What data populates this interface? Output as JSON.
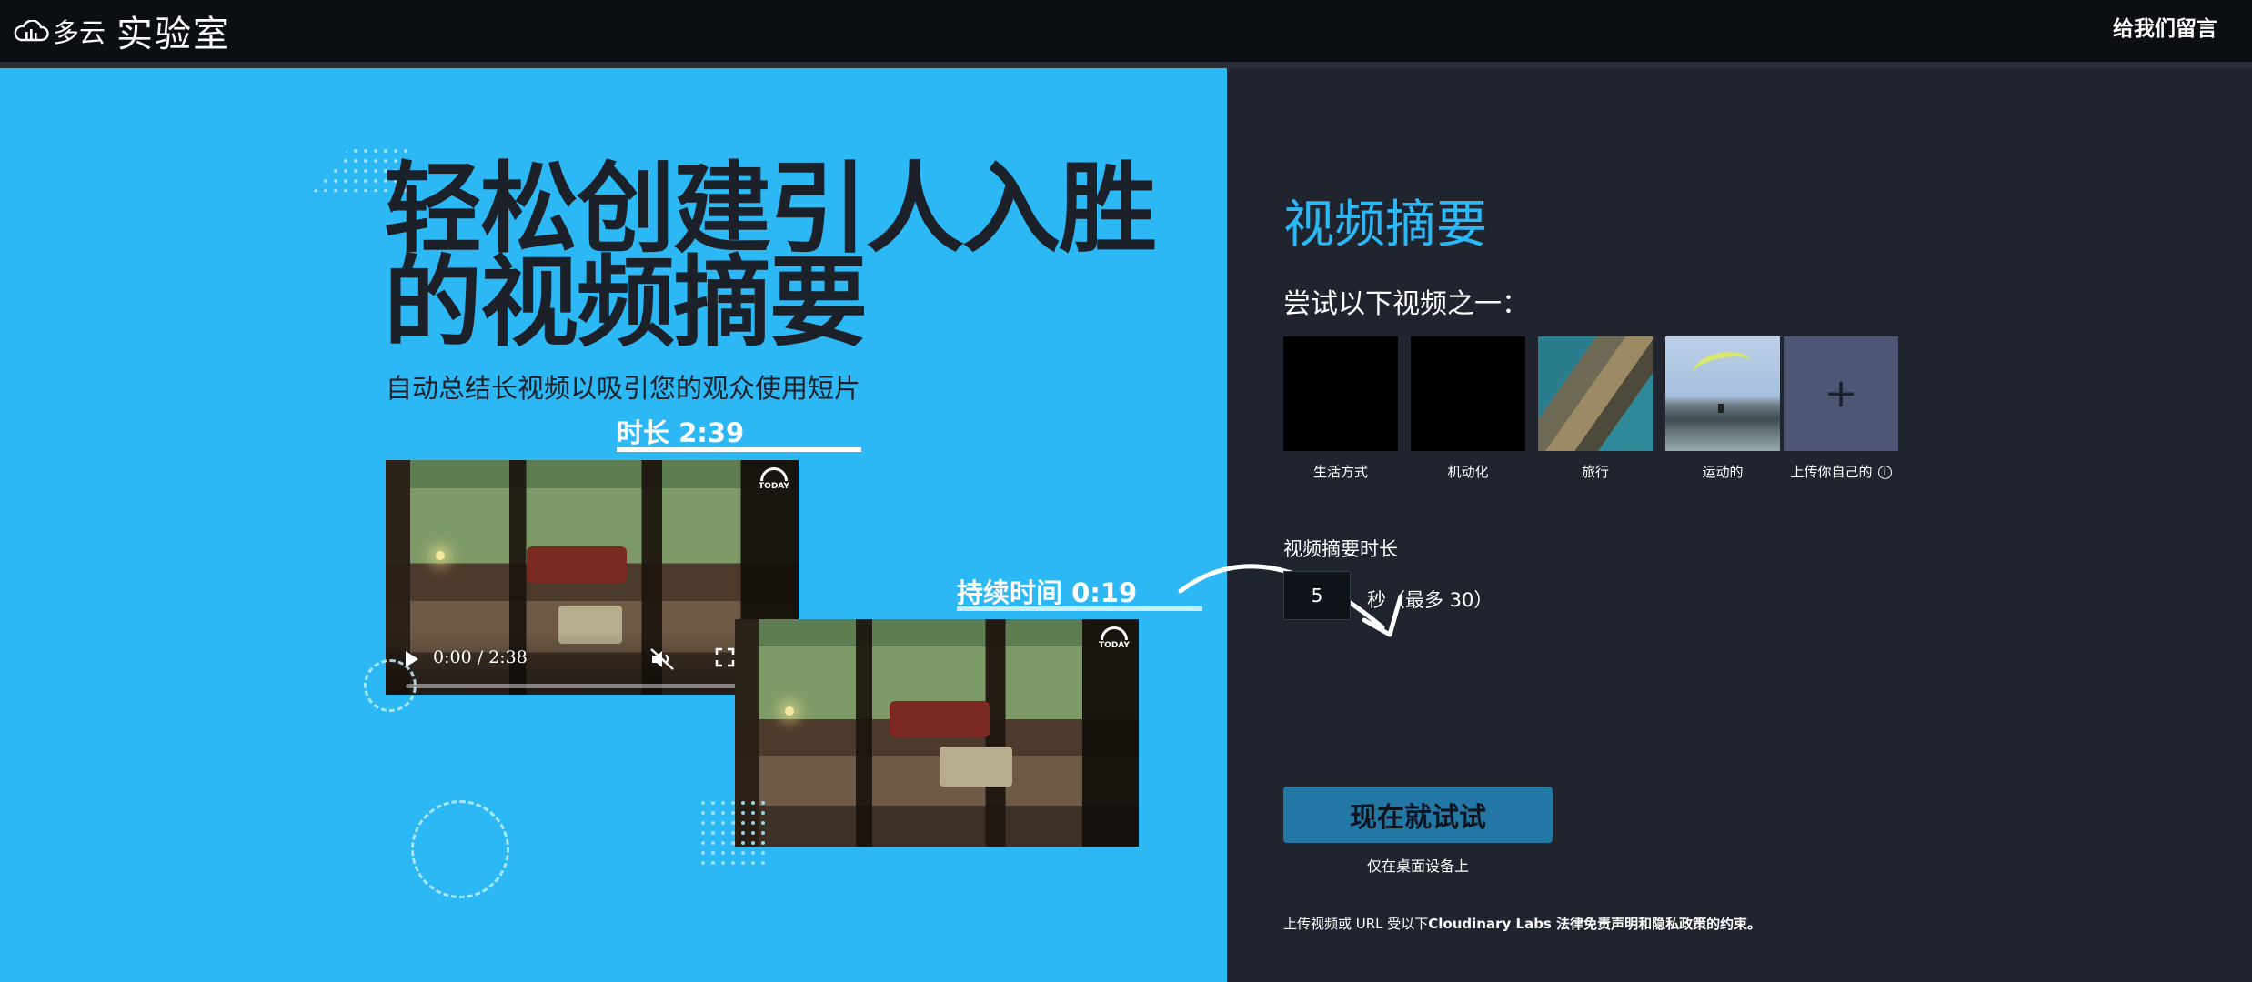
{
  "header": {
    "brand_small": "多云",
    "brand_big": "实验室",
    "feedback_label": "给我们留言"
  },
  "hero": {
    "title_line1": "轻松创建引人入胜",
    "title_line2": "的视频摘要",
    "subtitle": "自动总结长视频以吸引您的观众使用短片",
    "original_label": "时长 2:39",
    "summary_label": "持续时间 0:19",
    "player": {
      "time": "0:00 / 2:38",
      "progress": 0,
      "watermark": "TODAY"
    }
  },
  "panel": {
    "title": "视频摘要",
    "try_label": "尝试以下视频之一：",
    "samples": [
      {
        "label": "生活方式"
      },
      {
        "label": "机动化"
      },
      {
        "label": "旅行"
      },
      {
        "label": "运动的"
      }
    ],
    "upload_label": "上传你自己的",
    "length_label": "视频摘要时长",
    "length_value": "5",
    "length_unit": "秒（最多 30）",
    "cta_label": "现在就试试",
    "cta_note": "仅在桌面设备上",
    "legal_prefix": "上传视频或 URL 受以下",
    "legal_bold": "Cloudinary Labs 法律免责声明和隐私政策的约束。"
  },
  "colors": {
    "hero_bg": "#2bb8f5",
    "panel_bg": "#20242f",
    "accent": "#2bb8f5",
    "cta_bg": "#2377a4",
    "header_bg": "#0b0e13"
  }
}
